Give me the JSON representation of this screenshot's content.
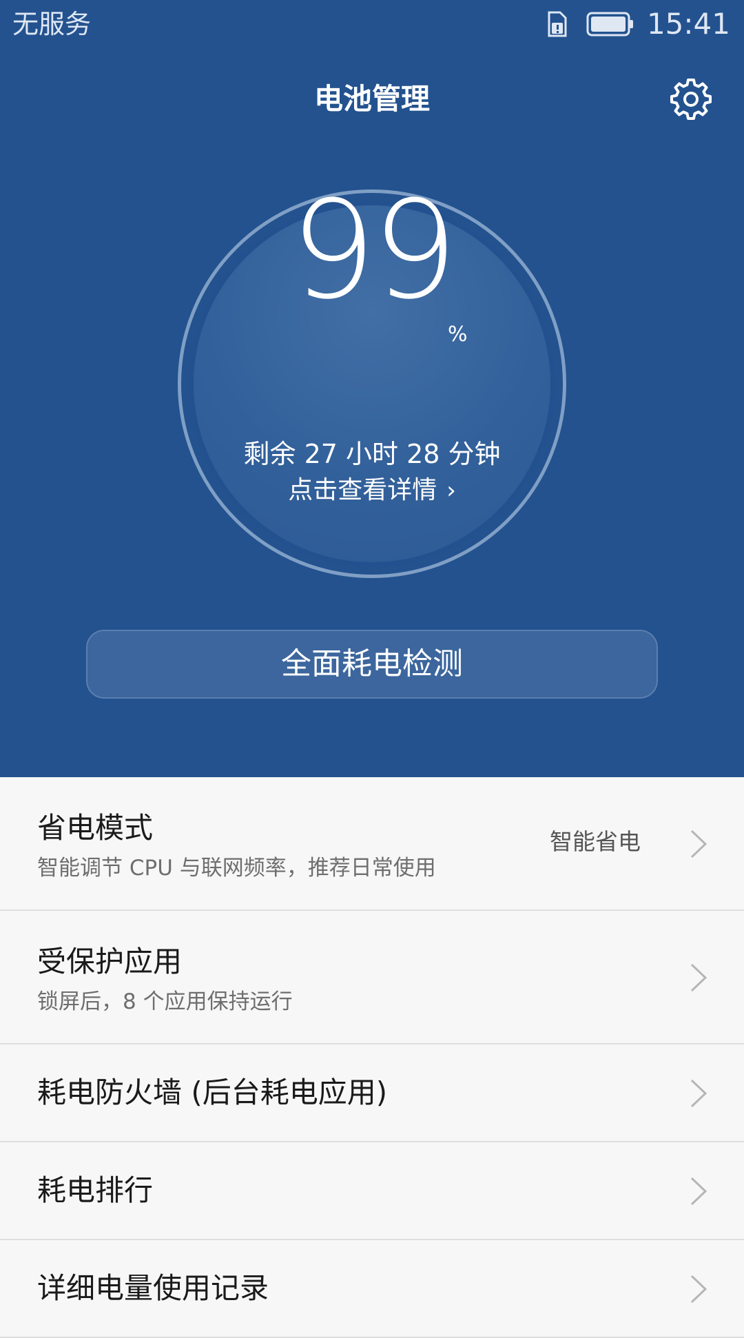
{
  "status_bar": {
    "carrier": "无服务",
    "time": "15:41",
    "icons": [
      "sim-alert-icon",
      "battery-full-icon"
    ]
  },
  "header": {
    "title": "电池管理",
    "settings_icon": "gear-icon"
  },
  "battery": {
    "percent": "99",
    "percent_sign": "%",
    "remaining": "剩余 27 小时 28 分钟",
    "details_link": "点击查看详情",
    "details_chevron": "›"
  },
  "check_button": {
    "label": "全面耗电检测"
  },
  "list": {
    "items": [
      {
        "title": "省电模式",
        "subtitle": "智能调节 CPU 与联网频率，推荐日常使用",
        "value": "智能省电"
      },
      {
        "title": "受保护应用",
        "subtitle": "锁屏后，8 个应用保持运行"
      },
      {
        "title": "耗电防火墙 (后台耗电应用)"
      },
      {
        "title": "耗电排行"
      },
      {
        "title": "详细电量使用记录"
      }
    ]
  },
  "colors": {
    "header_bg": "#23528f",
    "list_bg": "#f7f7f7",
    "text_primary": "#1a1a1a",
    "text_secondary": "#6e6e6e"
  }
}
